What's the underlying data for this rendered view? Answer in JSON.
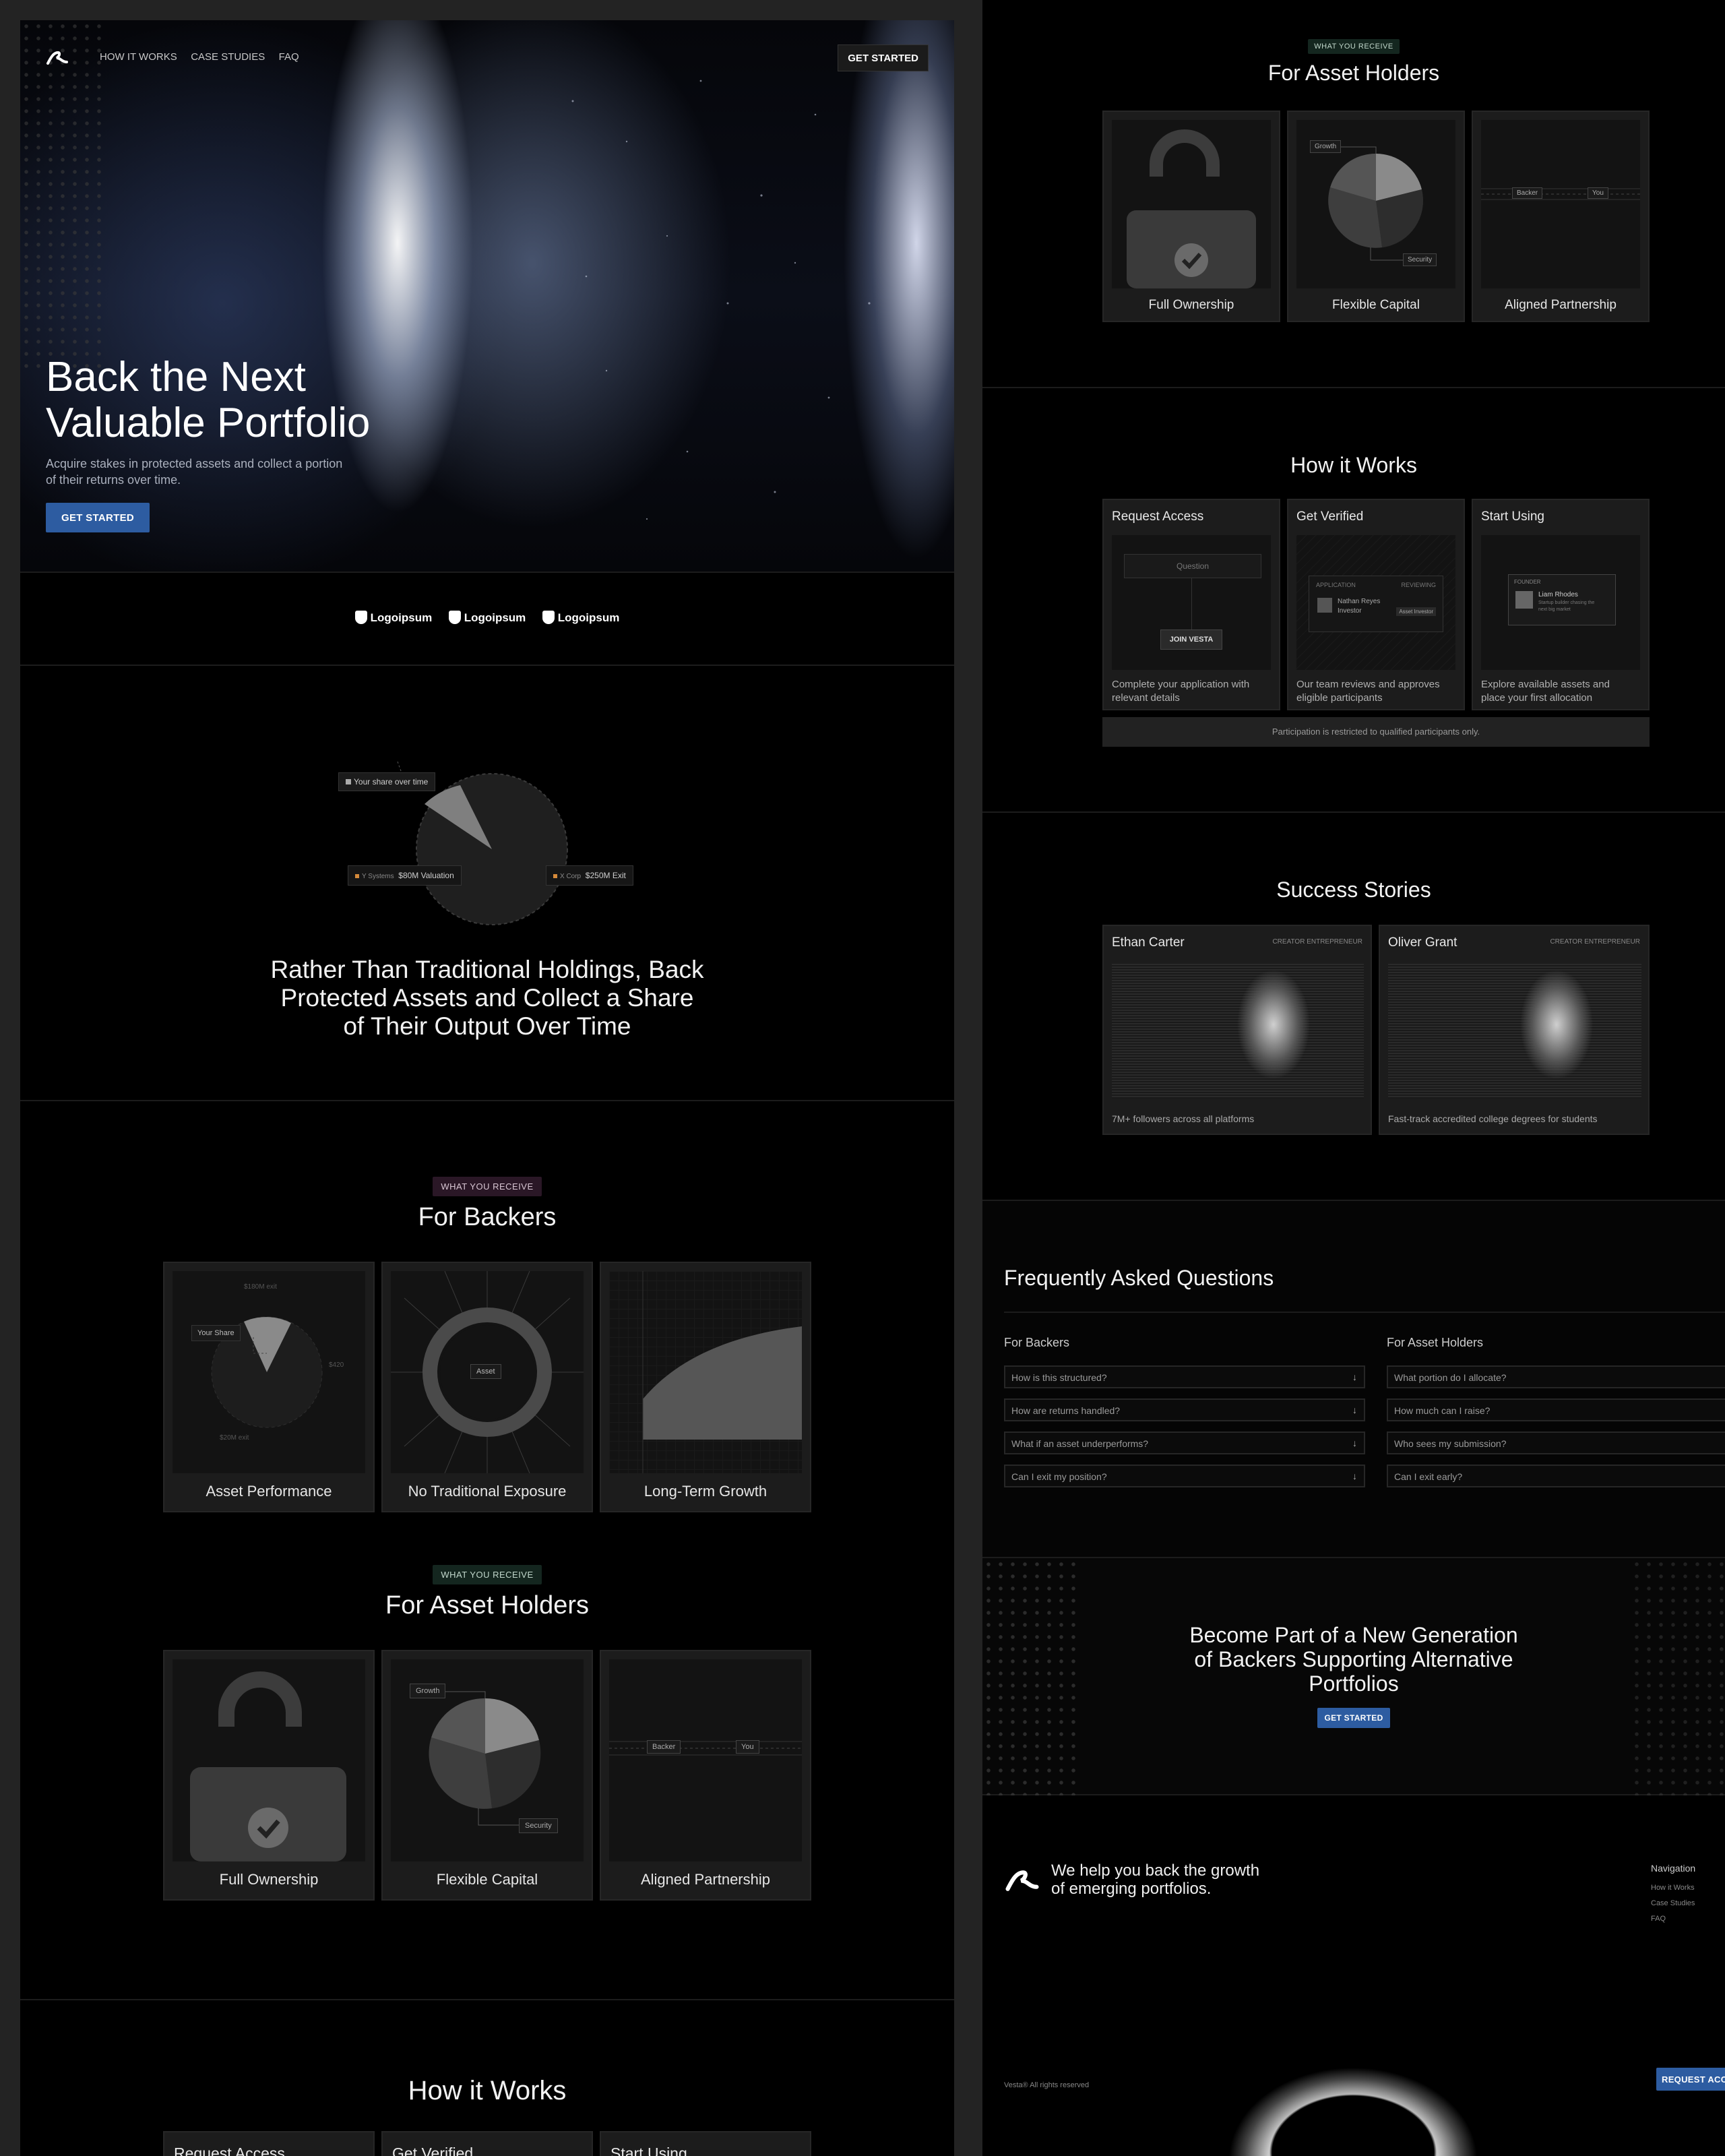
{
  "nav": {
    "links": [
      "HOW IT WORKS",
      "CASE STUDIES",
      "FAQ"
    ],
    "cta": "GET STARTED"
  },
  "hero": {
    "title_line1": "Back the Next",
    "title_line2": "Valuable Portfolio",
    "subtitle_line1": "Acquire stakes in protected assets and collect a portion",
    "subtitle_line2": "of their returns over time.",
    "cta": "GET STARTED"
  },
  "logos": [
    "Logoipsum",
    "Logoipsum",
    "Logoipsum"
  ],
  "share": {
    "chip_share": "Your share over time",
    "chip_y_name": "Y Systems",
    "chip_y_value": "$80M Valuation",
    "chip_x_name": "X Corp",
    "chip_x_value": "$250M Exit",
    "headline_l1": "Rather Than Traditional Holdings, Back",
    "headline_l2": "Protected Assets and Collect a Share",
    "headline_l3": "of Their Output Over Time"
  },
  "backers": {
    "tag": "WHAT YOU RECEIVE",
    "title": "For Backers",
    "cards": [
      "Asset Performance",
      "No Traditional Exposure",
      "Long-Term Growth"
    ],
    "chip_share": "Your Share",
    "chip_top": "$180M exit",
    "chip_right": "$420",
    "chip_bottom": "$20M exit",
    "asset_label": "Asset"
  },
  "holders": {
    "tag": "WHAT YOU RECEIVE",
    "title": "For Asset Holders",
    "cards": [
      "Full Ownership",
      "Flexible Capital",
      "Aligned Partnership"
    ],
    "chip_growth": "Growth",
    "chip_security": "Security",
    "chip_backer": "Backer",
    "chip_you": "You"
  },
  "how": {
    "title": "How it Works",
    "steps": [
      {
        "title": "Request Access",
        "desc_l1": "Complete your application with",
        "desc_l2": "relevant details"
      },
      {
        "title": "Get Verified",
        "desc_l1": "Our team reviews and approves",
        "desc_l2": "eligible participants"
      },
      {
        "title": "Start Using",
        "desc_l1": "Explore available assets and",
        "desc_l2": "place your first allocation"
      }
    ],
    "question": "Question",
    "join": "JOIN VESTA",
    "application": "APPLICATION",
    "reviewing": "REVIEWING",
    "person": "Nathan Reyes",
    "role": "Investor",
    "verified": "Asset Investor",
    "founder": "FOUNDER",
    "founder_name": "Liam Rhodes",
    "founder_desc1": "Startup builder chasing the",
    "founder_desc2": "next big market",
    "note": "Participation is restricted to qualified participants only."
  },
  "stories": {
    "title": "Success Stories",
    "items": [
      {
        "name": "Ethan Carter",
        "role": "CREATOR ENTREPRENEUR",
        "desc": "7M+ followers across all platforms"
      },
      {
        "name": "Oliver Grant",
        "role": "CREATOR ENTREPRENEUR",
        "desc": "Fast-track accredited college degrees for students"
      }
    ]
  },
  "faq": {
    "title": "Frequently Asked Questions",
    "backers_title": "For Backers",
    "holders_title": "For Asset Holders",
    "backers": [
      "How is this structured?",
      "How are returns handled?",
      "What if an asset underperforms?",
      "Can I exit my position?"
    ],
    "holders": [
      "What portion do I allocate?",
      "How much can I raise?",
      "Who sees my submission?",
      "Can I exit early?"
    ]
  },
  "cta": {
    "line1": "Become Part of a New Generation",
    "line2": "of Backers Supporting Alternative",
    "line3": "Portfolios",
    "button": "GET STARTED"
  },
  "footer": {
    "tagline_l1": "We help you back the growth",
    "tagline_l2": "of emerging portfolios.",
    "nav_title": "Navigation",
    "nav_links": [
      "How it Works",
      "Case Studies",
      "FAQ"
    ],
    "copyright": "Vesta® All rights reserved",
    "button": "REQUEST ACC"
  }
}
